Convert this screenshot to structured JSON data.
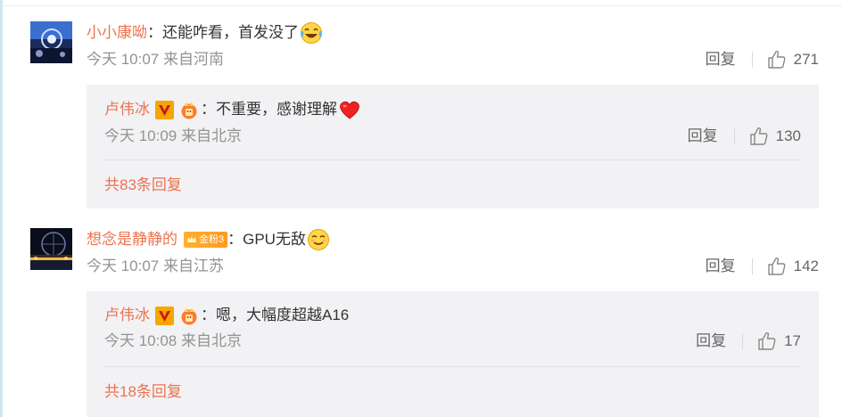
{
  "comments": [
    {
      "user": "小小康呦",
      "text": "还能咋看，首发没了",
      "emoji_icon": "laughing-tears-emoji",
      "time": "今天 10:07 来自河南",
      "reply_label": "回复",
      "likes": "271",
      "reply": {
        "user": "卢伟冰",
        "text": "不重要，感谢理解",
        "emoji_icon": "red-heart-emoji",
        "time": "今天 10:09 来自北京",
        "reply_label": "回复",
        "likes": "130"
      },
      "more_replies": "共83条回复"
    },
    {
      "user": "想念是静静的",
      "fan_badge": "金粉3",
      "text": "GPU无敌",
      "emoji_icon": "smirk-emoji",
      "time": "今天 10:07 来自江苏",
      "reply_label": "回复",
      "likes": "142",
      "reply": {
        "user": "卢伟冰",
        "text": "嗯，大幅度超越A16",
        "time": "今天 10:08 来自北京",
        "reply_label": "回复",
        "likes": "17"
      },
      "more_replies": "共18条回复"
    }
  ],
  "colors": {
    "username": "#eb7350",
    "meta": "#939393",
    "reply_bg": "#f2f2f5",
    "verified_v": "#f7a600"
  },
  "separator": "："
}
